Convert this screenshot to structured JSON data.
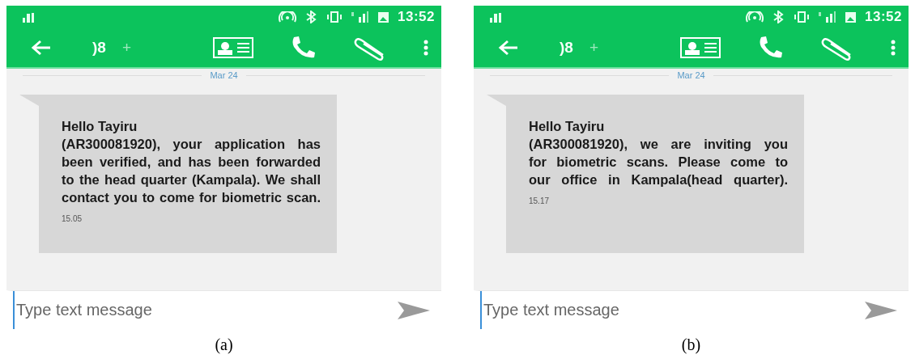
{
  "panels": [
    {
      "status_time": "13:52",
      "contact": ")8",
      "contact_suffix": "+",
      "date": "Mar 24",
      "message_lines": [
        "Hello Tayiru",
        "(AR300081920), your application has",
        "been verified, and has been forwarded",
        "to the head quarter (Kampala). We shall",
        "contact you to come for biometric scan."
      ],
      "message_time": "15.05",
      "input": {
        "placeholder": "Type text message"
      },
      "caption": "(a)"
    },
    {
      "status_time": "13:52",
      "contact": ")8",
      "contact_suffix": "+",
      "date": "Mar 24",
      "message_lines": [
        "Hello Tayiru",
        "(AR300081920), we are inviting you",
        "for biometric scans. Please come to",
        "our office in Kampala(head quarter)."
      ],
      "message_time": "15.17",
      "input": {
        "placeholder": "Type text message"
      },
      "caption": "(b)"
    }
  ]
}
